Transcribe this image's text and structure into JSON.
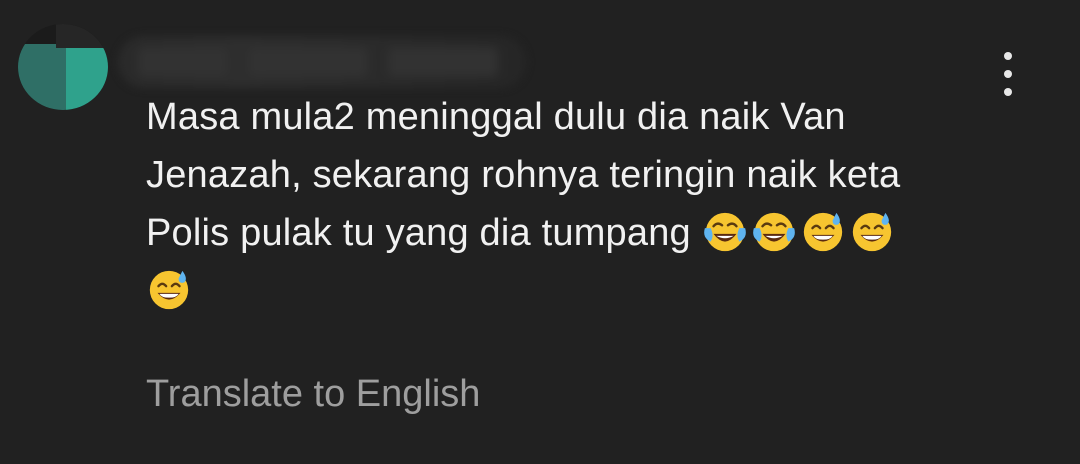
{
  "comment": {
    "text_lines": [
      "Masa mula2 meninggal dulu dia naik Van",
      "Jenazah, sekarang rohnya teringin naik keta",
      "Polis pulak tu yang dia tumpang"
    ],
    "emojis_line3": [
      "face-with-tears-of-joy",
      "face-with-tears-of-joy",
      "grinning-face-with-sweat",
      "grinning-face-with-sweat"
    ],
    "emojis_line4": [
      "grinning-face-with-sweat"
    ],
    "translate_label": "Translate to English"
  },
  "colors": {
    "background": "#212121",
    "text": "#f1f1f1",
    "secondary_text": "#9e9e9e",
    "avatar_accent": "#2e9e8a"
  }
}
